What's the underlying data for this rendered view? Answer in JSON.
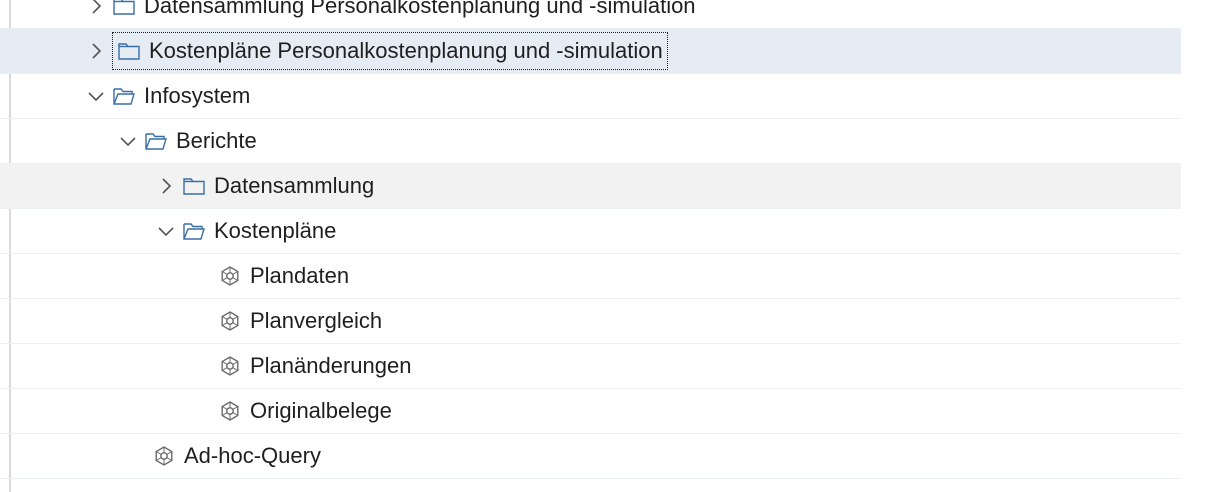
{
  "tree": {
    "items": [
      {
        "label": "Datensammlung Personalkostenplanung und -simulation",
        "icon": "folder-closed-icon",
        "toggle": "chevron-right"
      },
      {
        "label": "Kostenpläne Personalkostenplanung und -simulation",
        "icon": "folder-closed-icon",
        "toggle": "chevron-right"
      },
      {
        "label": "Infosystem",
        "icon": "folder-open-icon",
        "toggle": "chevron-down"
      },
      {
        "label": "Berichte",
        "icon": "folder-open-icon",
        "toggle": "chevron-down"
      },
      {
        "label": "Datensammlung",
        "icon": "folder-closed-icon",
        "toggle": "chevron-right"
      },
      {
        "label": "Kostenpläne",
        "icon": "folder-open-icon",
        "toggle": "chevron-down"
      },
      {
        "label": "Plandaten",
        "icon": "transaction-icon",
        "toggle": ""
      },
      {
        "label": "Planvergleich",
        "icon": "transaction-icon",
        "toggle": ""
      },
      {
        "label": "Planänderungen",
        "icon": "transaction-icon",
        "toggle": ""
      },
      {
        "label": "Originalbelege",
        "icon": "transaction-icon",
        "toggle": ""
      },
      {
        "label": "Ad-hoc-Query",
        "icon": "transaction-icon",
        "toggle": ""
      }
    ]
  },
  "colors": {
    "selected_row": "#e6ecf4",
    "hover_row": "#f2f2f2",
    "icon_stroke": "#3a6ea5",
    "text": "#1f1f1f"
  }
}
